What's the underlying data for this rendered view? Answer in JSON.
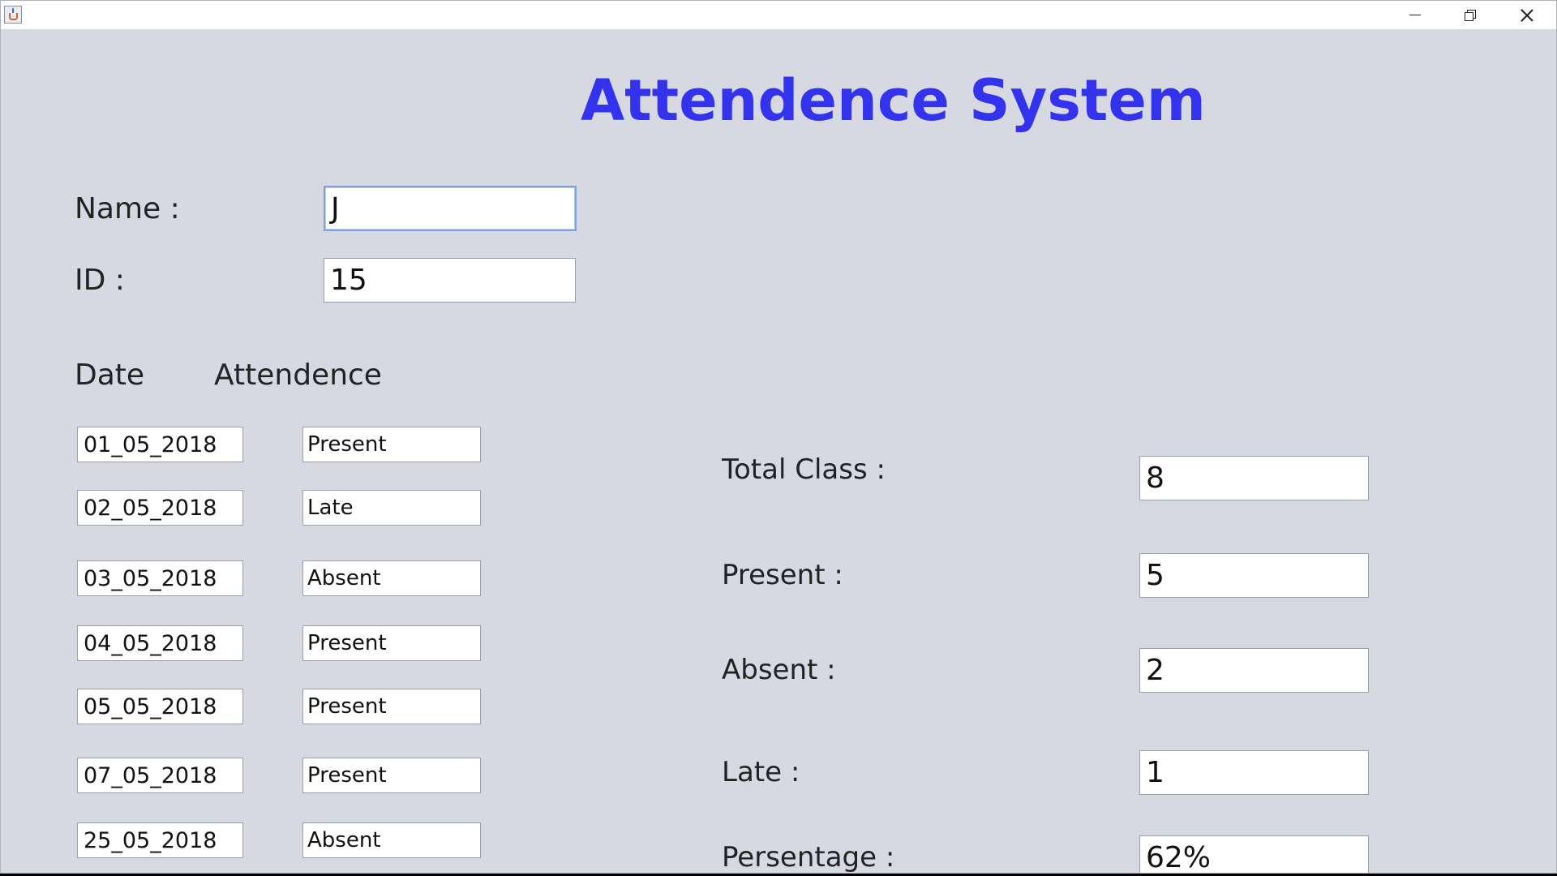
{
  "window": {
    "app_icon": "java-cup-icon"
  },
  "title": "Attendence System",
  "student": {
    "name_label": "Name :",
    "name_value": "J",
    "id_label": "ID :",
    "id_value": "15"
  },
  "table": {
    "date_header": "Date",
    "attendance_header": "Attendence",
    "rows": [
      {
        "date": "01_05_2018",
        "status": "Present"
      },
      {
        "date": "02_05_2018",
        "status": "Late"
      },
      {
        "date": "03_05_2018",
        "status": "Absent"
      },
      {
        "date": "04_05_2018",
        "status": "Present"
      },
      {
        "date": "05_05_2018",
        "status": "Present"
      },
      {
        "date": "07_05_2018",
        "status": "Present"
      },
      {
        "date": "25_05_2018",
        "status": "Absent"
      }
    ]
  },
  "stats": {
    "total_label": "Total Class :",
    "total_value": "8",
    "present_label": "Present :",
    "present_value": "5",
    "absent_label": "Absent :",
    "absent_value": "2",
    "late_label": "Late :",
    "late_value": "1",
    "percentage_label": "Persentage :",
    "percentage_value": "62%"
  },
  "colors": {
    "title": "#3333ee",
    "background": "#d6d9e1"
  }
}
